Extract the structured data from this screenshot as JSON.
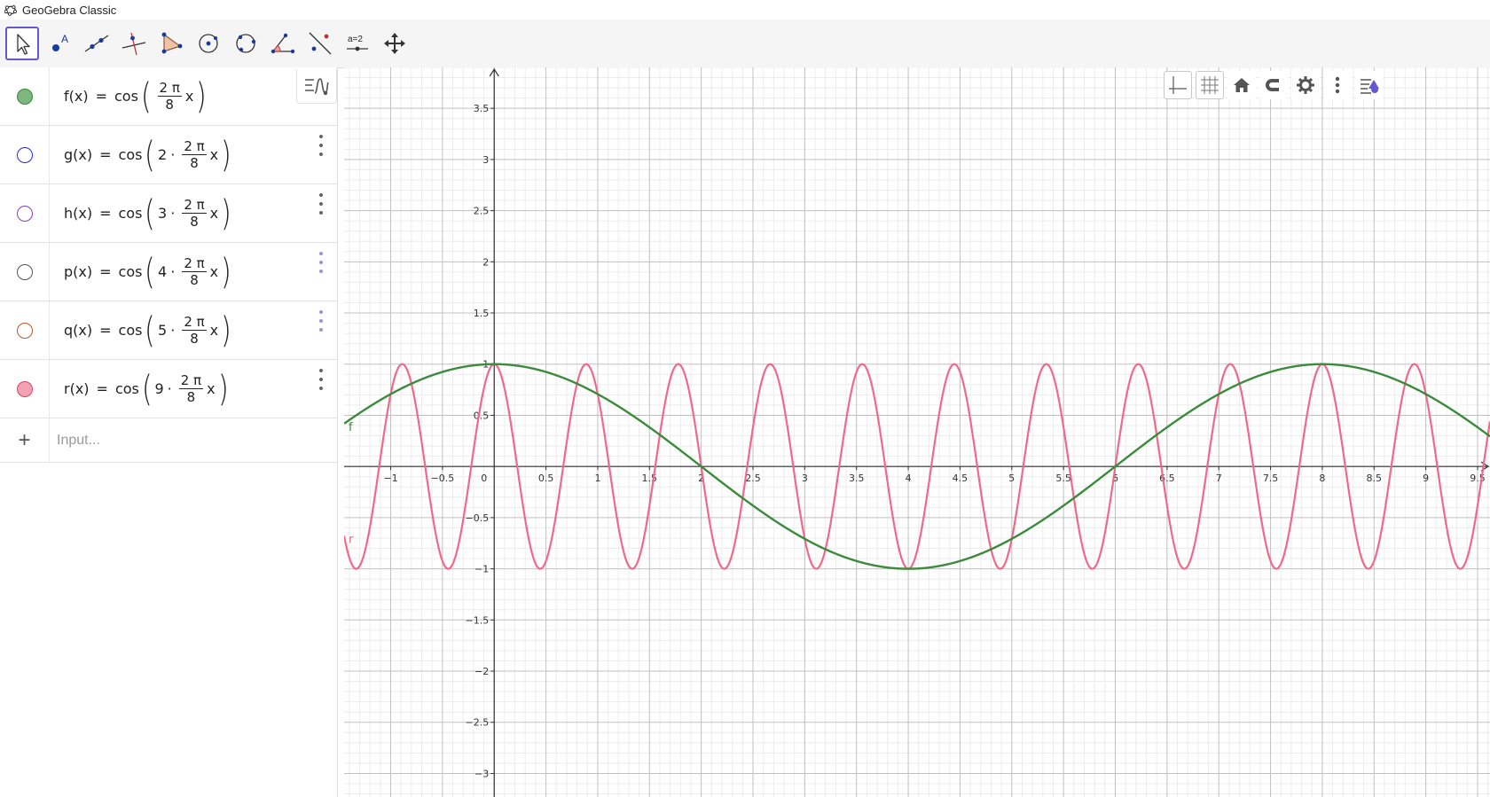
{
  "window": {
    "title": "GeoGebra Classic"
  },
  "toolbar": {
    "tools": [
      {
        "name": "move-tool",
        "active": true
      },
      {
        "name": "point-tool"
      },
      {
        "name": "line-tool"
      },
      {
        "name": "perpendicular-line-tool"
      },
      {
        "name": "polygon-tool"
      },
      {
        "name": "circle-center-point-tool"
      },
      {
        "name": "circle-three-points-tool"
      },
      {
        "name": "angle-tool"
      },
      {
        "name": "reflect-tool"
      },
      {
        "name": "slider-tool",
        "label": "a=2"
      },
      {
        "name": "move-graphics-view-tool"
      }
    ]
  },
  "algebra": {
    "rows": [
      {
        "name": "f",
        "lhs": "f(x)",
        "eq": "=",
        "fn": "cos",
        "multiplier": "",
        "num": "2 π",
        "den": "8",
        "var": "x",
        "color": "#2e8a2e",
        "fill": "#7fb57f",
        "filled": true
      },
      {
        "name": "g",
        "lhs": "g(x)",
        "eq": "=",
        "fn": "cos",
        "multiplier": "2",
        "num": "2 π",
        "den": "8",
        "var": "x",
        "color": "#2a2ad6",
        "fill": "#ffffff",
        "filled": false
      },
      {
        "name": "h",
        "lhs": "h(x)",
        "eq": "=",
        "fn": "cos",
        "multiplier": "3",
        "num": "2 π",
        "den": "8",
        "var": "x",
        "color": "#8a3db8",
        "fill": "#ffffff",
        "filled": false
      },
      {
        "name": "p",
        "lhs": "p(x)",
        "eq": "=",
        "fn": "cos",
        "multiplier": "4",
        "num": "2 π",
        "den": "8",
        "var": "x",
        "color": "#555555",
        "fill": "#ffffff",
        "filled": false
      },
      {
        "name": "q",
        "lhs": "q(x)",
        "eq": "=",
        "fn": "cos",
        "multiplier": "5",
        "num": "2 π",
        "den": "8",
        "var": "x",
        "color": "#b05a2a",
        "fill": "#ffffff",
        "filled": false
      },
      {
        "name": "r",
        "lhs": "r(x)",
        "eq": "=",
        "fn": "cos",
        "multiplier": "9",
        "num": "2 π",
        "den": "8",
        "var": "x",
        "color": "#d6456b",
        "fill": "#f3a1b5",
        "filled": true
      }
    ],
    "input_placeholder": "Input..."
  },
  "graph": {
    "x_ticks": [
      "−1",
      "−0.5",
      "0",
      "0.5",
      "1",
      "1.5",
      "2",
      "2.5",
      "3",
      "3.5",
      "4",
      "4.5",
      "5",
      "5.5",
      "6",
      "6.5",
      "7",
      "7.5",
      "8",
      "8.5",
      "9",
      "9.5"
    ],
    "y_ticks": [
      "3.5",
      "3",
      "2.5",
      "2",
      "1.5",
      "1",
      "0.5",
      "−0.5",
      "−1",
      "−1.5",
      "−2",
      "−2.5",
      "−3"
    ],
    "label_f": "f",
    "label_r": "r",
    "colors": {
      "f": "#3c8a3c",
      "r": "#ee6a8a",
      "grid_major": "#c0c0c0",
      "grid_minor": "#ececec",
      "axis": "#333333"
    }
  },
  "chart_data": {
    "type": "line",
    "xlim": [
      -1.45,
      9.62
    ],
    "ylim": [
      -3.23,
      3.9
    ],
    "series": [
      {
        "name": "f",
        "formula": "cos(2π/8 · x)",
        "k": 1
      },
      {
        "name": "r",
        "formula": "cos(9 · 2π/8 · x)",
        "k": 9
      }
    ],
    "grid": true
  }
}
